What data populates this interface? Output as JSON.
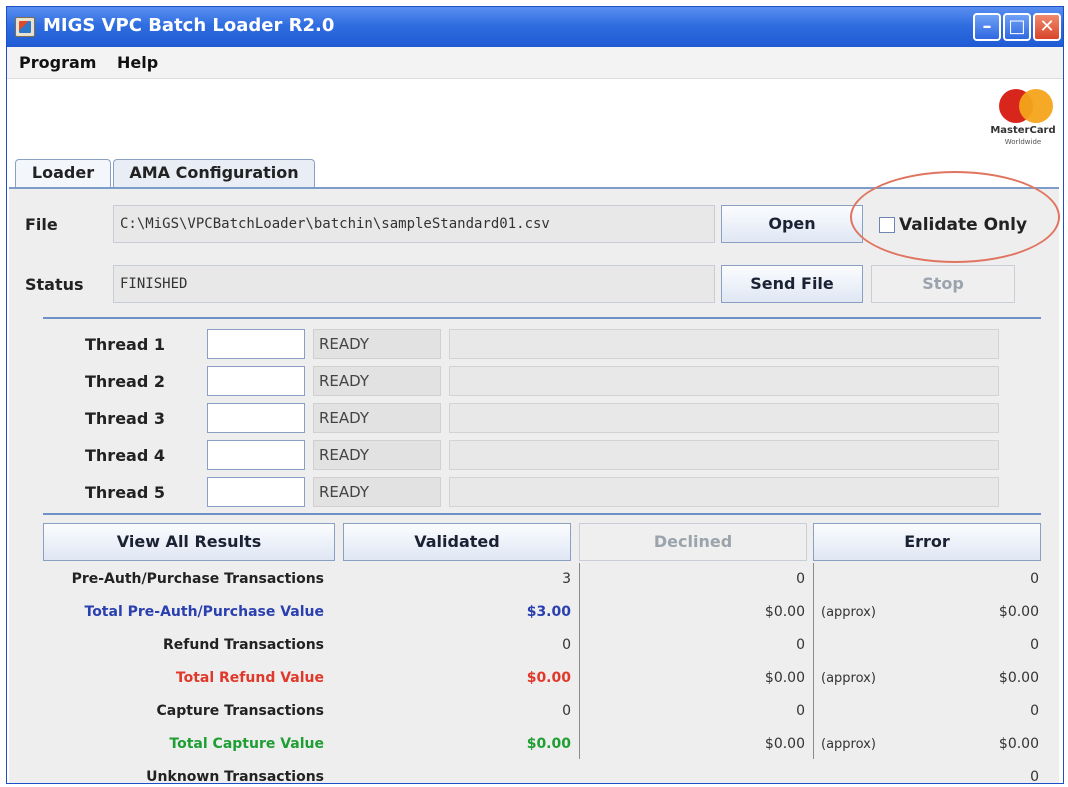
{
  "window": {
    "title": "MIGS VPC Batch Loader R2.0"
  },
  "menu": {
    "program": "Program",
    "help": "Help"
  },
  "logo": {
    "brand": "MasterCard",
    "sub": "Worldwide"
  },
  "tabs": [
    {
      "label": "Loader"
    },
    {
      "label": "AMA Configuration"
    }
  ],
  "file": {
    "label": "File",
    "path": "C:\\MiGS\\VPCBatchLoader\\batchin\\sampleStandard01.csv",
    "open": "Open",
    "validate_only": "Validate Only"
  },
  "status": {
    "label": "Status",
    "value": "FINISHED",
    "send": "Send File",
    "stop": "Stop"
  },
  "threads": [
    {
      "label": "Thread 1",
      "state": "READY"
    },
    {
      "label": "Thread 2",
      "state": "READY"
    },
    {
      "label": "Thread 3",
      "state": "READY"
    },
    {
      "label": "Thread 4",
      "state": "READY"
    },
    {
      "label": "Thread 5",
      "state": "READY"
    }
  ],
  "results": {
    "buttons": {
      "all": "View All Results",
      "validated": "Validated",
      "declined": "Declined",
      "error": "Error"
    },
    "rows": [
      {
        "label": "Pre-Auth/Purchase Transactions",
        "validated": "3",
        "declined": "0",
        "approx": "",
        "error": "0"
      },
      {
        "label": "Total Pre-Auth/Purchase Value",
        "validated": "$3.00",
        "declined": "$0.00",
        "approx": "(approx)",
        "error": "$0.00"
      },
      {
        "label": "Refund Transactions",
        "validated": "0",
        "declined": "0",
        "approx": "",
        "error": "0"
      },
      {
        "label": "Total Refund Value",
        "validated": "$0.00",
        "declined": "$0.00",
        "approx": "(approx)",
        "error": "$0.00"
      },
      {
        "label": "Capture Transactions",
        "validated": "0",
        "declined": "0",
        "approx": "",
        "error": "0"
      },
      {
        "label": "Total Capture Value",
        "validated": "$0.00",
        "declined": "$0.00",
        "approx": "(approx)",
        "error": "$0.00"
      },
      {
        "label": "Unknown Transactions",
        "validated": "",
        "declined": "",
        "approx": "",
        "error": "0"
      }
    ]
  },
  "colors": {
    "blue_value": "#2a3fb0",
    "red_value": "#e0392a",
    "green_value": "#1f9e34",
    "accent": "#2f6de0"
  }
}
